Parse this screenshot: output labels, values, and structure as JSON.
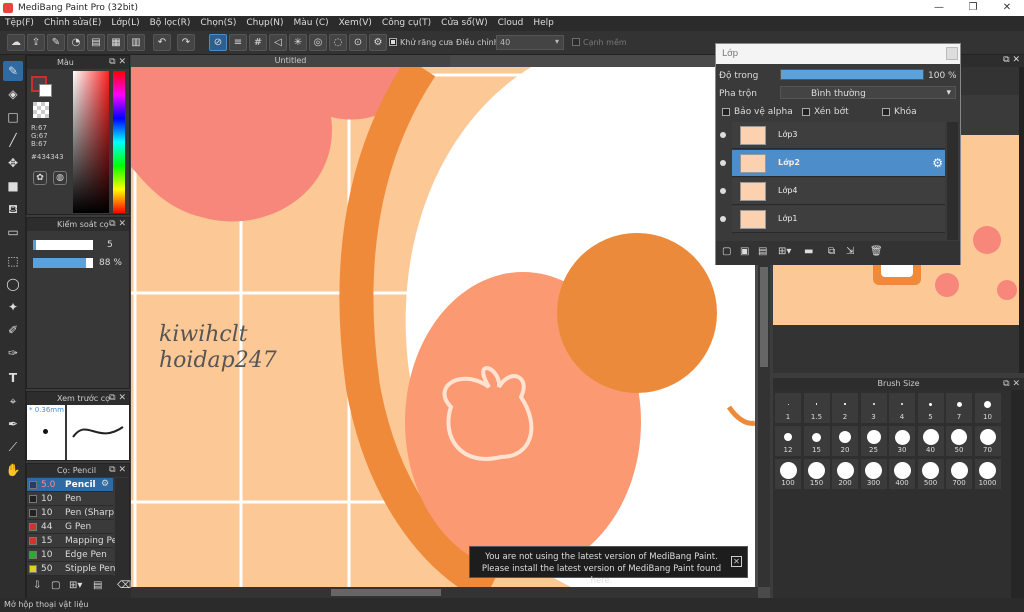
{
  "window": {
    "title": "MediBang Paint Pro (32bit)"
  },
  "menu": [
    "Tệp(F)",
    "Chỉnh sửa(E)",
    "Lớp(L)",
    "Bộ lọc(R)",
    "Chọn(S)",
    "Chụp(N)",
    "Màu (C)",
    "Xem(V)",
    "Công cụ(T)",
    "Cửa sổ(W)",
    "Cloud",
    "Help"
  ],
  "toolbar": {
    "antialias_label": "Khử răng cưa",
    "adjust_label": "Điều chỉnh",
    "adjust_value": "40",
    "edge_label": "Cạnh mềm"
  },
  "color_panel": {
    "title": "Màu",
    "r": "R:67",
    "g": "G:67",
    "b": "B:67",
    "hex": "#434343",
    "primary": "#434343",
    "accent": "#e8463d"
  },
  "brush_control": {
    "title": "Kiểm soát cọ",
    "size": "5",
    "opacity": "88 %"
  },
  "brush_preview": {
    "title": "Xem trước cọ",
    "size": "* 0.36mm"
  },
  "brush_list": {
    "title": "Cọ: Pencil",
    "items": [
      {
        "size": "5.0",
        "name": "Pencil",
        "color": "#1e3f66"
      },
      {
        "size": "10",
        "name": "Pen",
        "color": "#222222"
      },
      {
        "size": "10",
        "name": "Pen (Sharp)",
        "color": "#222222"
      },
      {
        "size": "44",
        "name": "G Pen",
        "color": "#d0342c"
      },
      {
        "size": "15",
        "name": "Mapping Pen",
        "color": "#d0342c"
      },
      {
        "size": "10",
        "name": "Edge Pen",
        "color": "#2eaa2e"
      },
      {
        "size": "50",
        "name": "Stipple Pen",
        "color": "#e0d020"
      }
    ]
  },
  "document": {
    "tab": "Untitled",
    "watermark_line1": "kiwihclt",
    "watermark_line2": "hoidap247"
  },
  "layer_panel": {
    "title": "Lớp",
    "opacity_label": "Độ trong",
    "opacity_value": "100 %",
    "opacity": 1.0,
    "blend_label": "Pha trộn",
    "blend_value": "Bình thường",
    "protect_alpha": "Bảo vệ alpha",
    "clipping": "Xén bớt",
    "lock": "Khóa",
    "layers": [
      "Lớp3",
      "Lớp2",
      "Lớp4",
      "Lớp1"
    ],
    "selected": "Lớp2"
  },
  "brush_size_panel": {
    "title": "Brush Size",
    "sizes": [
      "1",
      "1.5",
      "2",
      "3",
      "4",
      "5",
      "7",
      "10",
      "12",
      "15",
      "20",
      "25",
      "30",
      "40",
      "50",
      "70",
      "100",
      "150",
      "200",
      "300",
      "400",
      "500",
      "700",
      "1000"
    ]
  },
  "notice": {
    "line1": "You are not using the latest version of MediBang Paint.",
    "line2": "Please install the latest version of MediBang Paint found here."
  },
  "status": {
    "text": "Mở hộp thoại vật liệu"
  }
}
